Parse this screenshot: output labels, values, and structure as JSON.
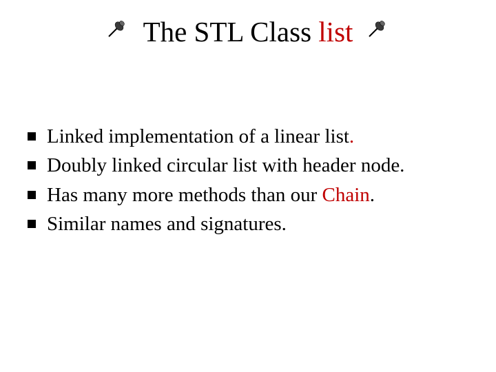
{
  "title": {
    "prefix": "The STL Class ",
    "emph": "list"
  },
  "bullets": [
    {
      "text": "Linked implementation of a linear list",
      "suffix": "."
    },
    {
      "text": "Doubly linked circular list with header node."
    },
    {
      "text_before": "Has many more methods than our ",
      "emph": "Chain",
      "text_after": "."
    },
    {
      "text": "Similar names and signatures."
    }
  ]
}
